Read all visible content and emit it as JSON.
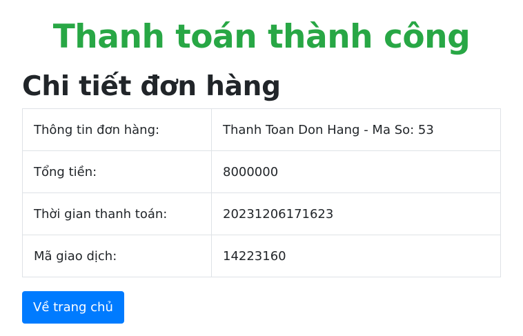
{
  "header": {
    "success_message": "Thanh toán thành công",
    "section_title": "Chi tiết đơn hàng"
  },
  "order_details": {
    "rows": [
      {
        "label": "Thông tin đơn hàng:",
        "value": "Thanh Toan Don Hang - Ma So: 53"
      },
      {
        "label": "Tổng tiền:",
        "value": "8000000"
      },
      {
        "label": "Thời gian thanh toán:",
        "value": "20231206171623"
      },
      {
        "label": "Mã giao dịch:",
        "value": "14223160"
      }
    ]
  },
  "actions": {
    "home_button_label": "Về trang chủ"
  },
  "colors": {
    "success": "#28a745",
    "primary": "#007bff",
    "border": "#dee2e6",
    "text": "#212529"
  }
}
